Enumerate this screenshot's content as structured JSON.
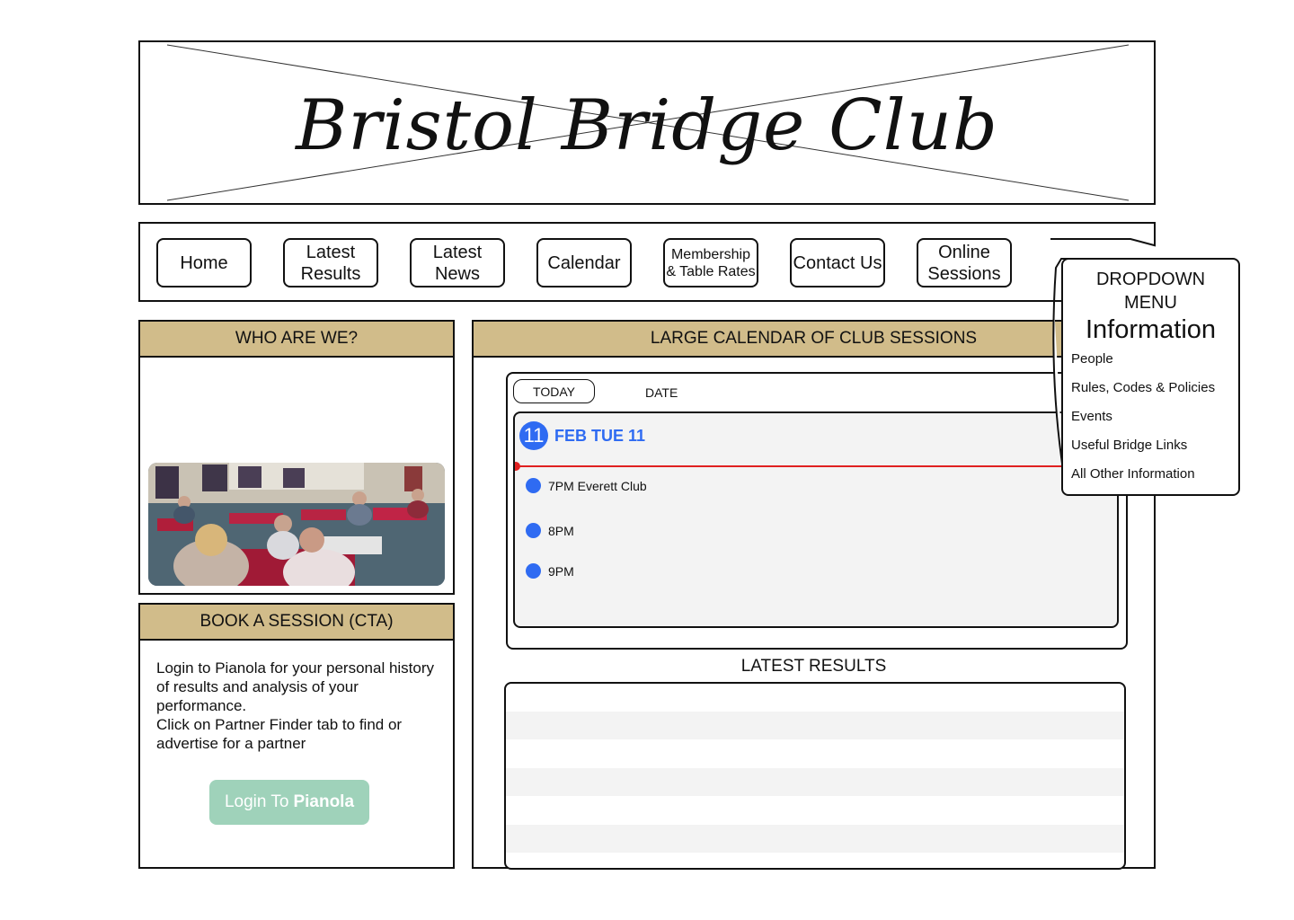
{
  "header": {
    "title": "Bristol Bridge Club"
  },
  "nav": {
    "items": [
      {
        "label_line1": "Home",
        "label_line2": ""
      },
      {
        "label_line1": "Latest",
        "label_line2": "Results"
      },
      {
        "label_line1": "Latest",
        "label_line2": "News"
      },
      {
        "label_line1": "Calendar",
        "label_line2": ""
      },
      {
        "label_line1": "Membership",
        "label_line2": "& Table Rates"
      },
      {
        "label_line1": "Contact Us",
        "label_line2": ""
      },
      {
        "label_line1": "Online",
        "label_line2": "Sessions"
      }
    ]
  },
  "dropdown": {
    "title_line1": "DROPDOWN",
    "title_line2": "MENU",
    "heading": "Information",
    "items": [
      "People",
      "Rules, Codes & Policies",
      "Events",
      "Useful Bridge Links",
      "All Other Information"
    ]
  },
  "who": {
    "title": "WHO ARE WE?"
  },
  "book": {
    "title": "BOOK A SESSION (CTA)",
    "text_line1": "Login to Pianola for your personal history of results and analysis of your performance.",
    "text_line2": "Click on Partner Finder tab to find or advertise for a partner",
    "login_prefix": "Login To",
    "login_brand": "Pianola"
  },
  "calendar": {
    "title": "LARGE CALENDAR OF CLUB SESSIONS",
    "today_label": "TODAY",
    "date_label": "DATE",
    "day_number": "11",
    "day_label": "FEB TUE 11",
    "events": [
      "7PM Everett Club",
      "8PM",
      "9PM"
    ],
    "accent_color": "#2f6bf2",
    "now_line_color": "#e02020"
  },
  "results": {
    "title": "LATEST RESULTS"
  },
  "colors": {
    "panel_header": "#d1bc8a",
    "login_button": "#9fd2ba"
  }
}
